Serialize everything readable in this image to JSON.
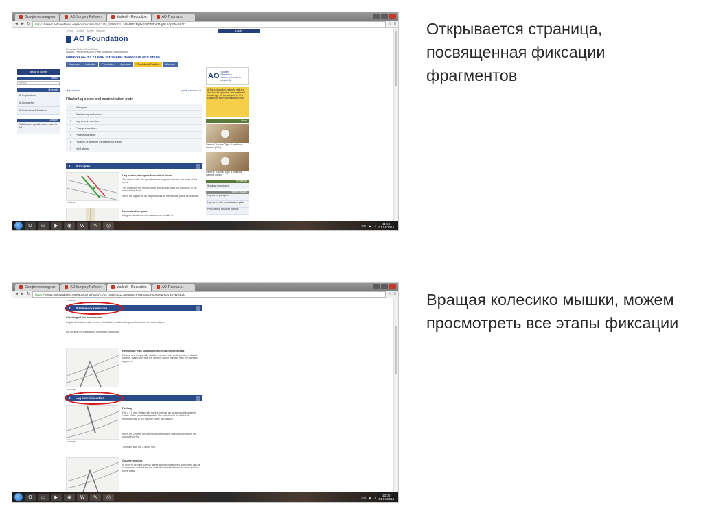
{
  "browser": {
    "tabs": [
      "Google переводчик",
      "AO Surgery Referen",
      "Malleoli - Reduction",
      "AO Trauma.ru"
    ],
    "url_prefix": "https://",
    "url_rest": "www2.aofoundation.org/wps/portal/!ut/p/c1/04_SB8K8xLLM9MSSzPy8xBz9CP0os3NgRUVqSWvBKzfz"
  },
  "screen1": {
    "page": {
      "top_line": "Home · Contact · Donate · Sitemap",
      "login": "Login",
      "logo": "AO Foundation",
      "editors": [
        "Executive Editor: Chris Colton",
        "Authors: Pietro Regazzoni, Peter Alexander Stanislavovich"
      ],
      "procedure_title": "Malleoli 44-B3.2 ORIF for lateral malleolus and fibula",
      "steps": [
        "Diagnosis",
        "Indication",
        "Preparation",
        "Approach",
        "Reduction & Fixation",
        "Aftercare"
      ],
      "back_button": "Back to home",
      "search_header": "Search",
      "search_placeholder": "Search",
      "side_menu_header": "Shortcuts",
      "side_menu_items": [
        "All Preparations",
        "All Approaches",
        "All Reductions & Fixations"
      ],
      "glossary_header": "Glossary",
      "glossary_text": "Definitions of specific terms found in AO",
      "nav_prev": "◄ previous",
      "nav_print": "print",
      "nav_next": "proceed ►",
      "subtitle": "Fibular lag screw and neutralization plate",
      "toc": [
        {
          "n": "1",
          "label": "Principles"
        },
        {
          "n": "2",
          "label": "Preliminary reduction"
        },
        {
          "n": "3",
          "label": "Lag screw insertion"
        },
        {
          "n": "4",
          "label": "Plate preparation"
        },
        {
          "n": "5",
          "label": "Plate application"
        },
        {
          "n": "6",
          "label": "Fixation of anterior syndesmotic injury"
        },
        {
          "n": "7",
          "label": "Next steps"
        }
      ],
      "section": {
        "n": "1",
        "title": "Principles"
      },
      "p1_title": "Lag screw principles for cortical bone",
      "p1_text": [
        "The thread pulls the opposite bone fragment towards the head of the screw.",
        "The portion of the thread in the gliding hole does not purchase in the surrounding bone.",
        "Insert the lag screw as perpendicular to the fracture plane as possible."
      ],
      "enlarge": "enlarge",
      "p2_title": "Neutralization plate",
      "p2_text": "A lag screw osteosynthesis alone is not able to",
      "ao_logo_big": "AO",
      "ao_logo_small": [
        "Surgery",
        "Reference",
        "Online reference in clinical life"
      ],
      "yellow_text": "AO is a physician network, with the aim to hold operative and treatment knowledge for the surgeon to fit a solution to each individual fracture",
      "video_header": "Video",
      "videos": [
        "General Trauma: Type B malleolar fracture (20m)",
        "General Trauma: Type B malleolar fracture (9min)"
      ],
      "elearning_header": "eLearning",
      "elearning_items": [
        "Surgical procedures"
      ],
      "further_header": "Further reading",
      "further_items": [
        "Lag screw principles",
        "Lag screw with neutralization plate",
        "Principles of absolute fixation"
      ]
    },
    "caption": "Открывается страница, посвященная фиксации фрагментов",
    "clock": {
      "time": "11:59",
      "date": "01.04.2014"
    }
  },
  "screen2": {
    "page": {
      "enlarge": "enlarge",
      "sect2": {
        "n": "2",
        "title": "Preliminary reduction"
      },
      "s2_heading": "Cleaning of the fracture site",
      "s2_text": [
        "Irrigate the fracture site, remove blood clots, and free the periosteum from the bone edges.",
        "Do not strip the periosteum more than necessary."
      ],
      "s2b_title": "Reduction with small pointed reduction forceps",
      "s2b_text": "Reduce and temporarily hold the fracture with small pointed reduction forceps, taking care that the forceps do not interfere with the planned lag screw.",
      "sect3": {
        "n": "3",
        "title": "Lag screw insertion"
      },
      "s3_title": "Drilling",
      "s3_text": [
        "Drill a 3.5 mm gliding hole for the cortical lag screw into the anterior cortex of the proximal fragment. The hole should be drilled as perpendicular to the fracture plane as possible.",
        "Insert the 2.5 mm drill sleeve into the gliding hole until it reaches the opposite cortex.",
        "Then drill with the 2.5 mm drill."
      ],
      "s4_title": "Countersinking",
      "s4_text": "In order to prevent cortical stress and micro fractures, the cortex can be countersunk to increase the area of contact between the bone and the screw head."
    },
    "caption": "Вращая колесико мышки, можем просмотреть все этапы фиксации",
    "clock": {
      "time": "12:00",
      "date": "01.04.2014"
    }
  },
  "taskbar": {
    "lang": "EN",
    "icons": [
      "windows-start",
      "opera",
      "explorer",
      "media-player",
      "chrome",
      "word",
      "paint",
      "utility"
    ]
  },
  "colors": {
    "accent": "#2b4a8a",
    "highlight_ring": "#d41b1b",
    "step_active": "#f2c12e"
  }
}
